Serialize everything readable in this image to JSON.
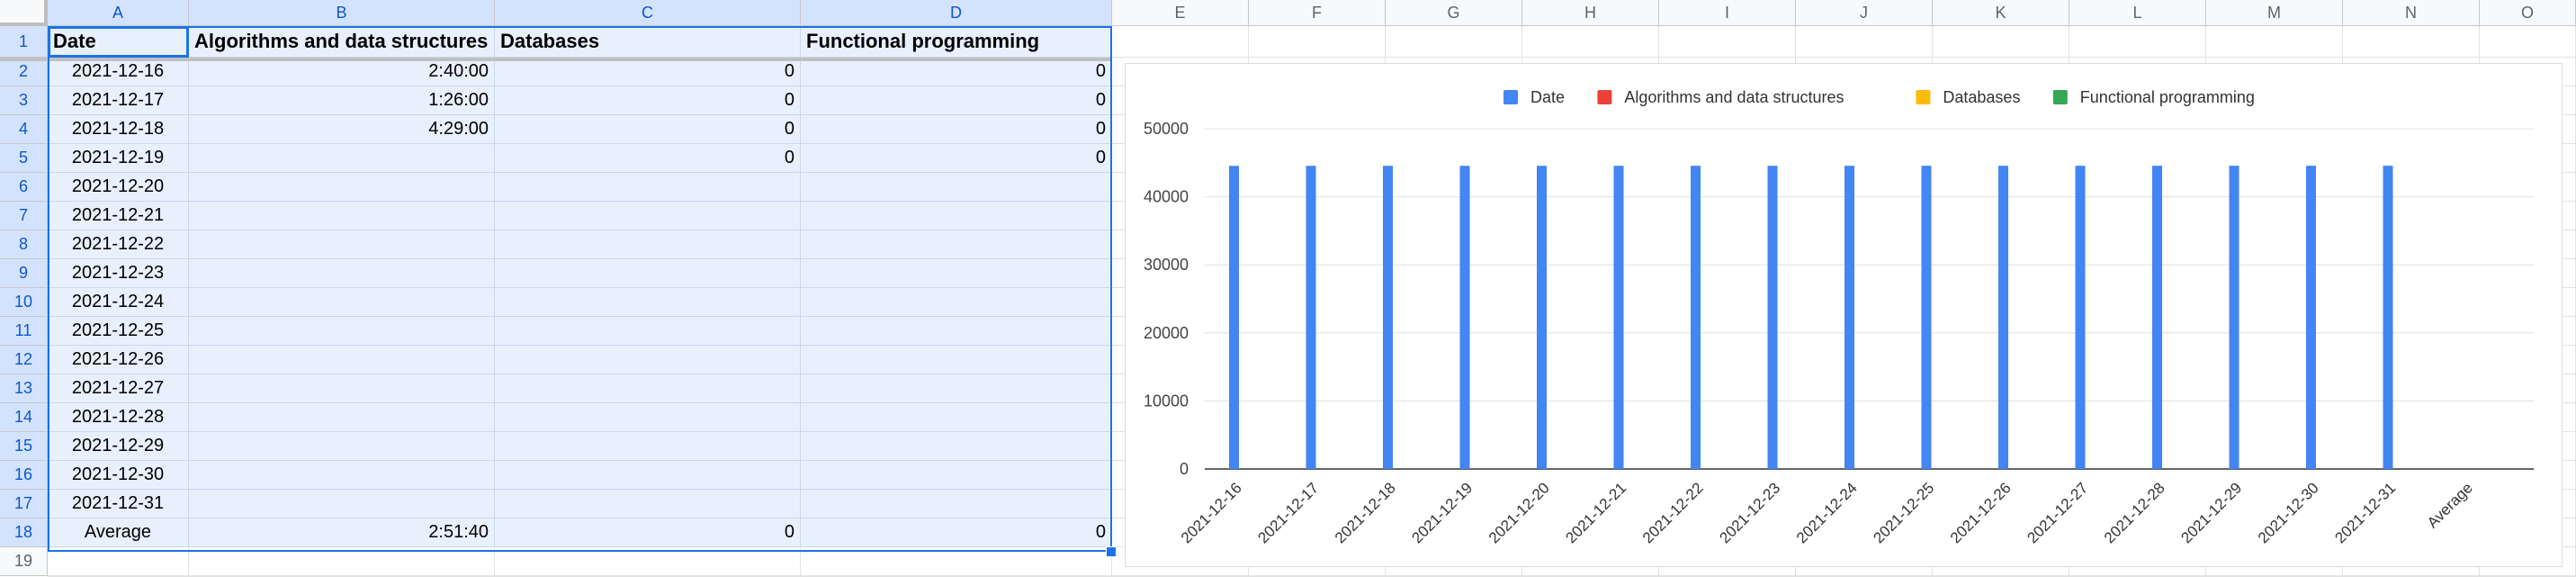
{
  "columns": [
    "A",
    "B",
    "C",
    "D",
    "E",
    "F",
    "G",
    "H",
    "I",
    "J",
    "K",
    "L",
    "M",
    "N",
    "O"
  ],
  "rows": [
    "1",
    "2",
    "3",
    "4",
    "5",
    "6",
    "7",
    "8",
    "9",
    "10",
    "11",
    "12",
    "13",
    "14",
    "15",
    "16",
    "17",
    "18",
    "19"
  ],
  "header": [
    "Date",
    "Algorithms and data structures",
    "Databases",
    "Functional programming"
  ],
  "table": [
    [
      "2021-12-16",
      "2:40:00",
      "0",
      "0"
    ],
    [
      "2021-12-17",
      "1:26:00",
      "0",
      "0"
    ],
    [
      "2021-12-18",
      "4:29:00",
      "0",
      "0"
    ],
    [
      "2021-12-19",
      "",
      "0",
      "0"
    ],
    [
      "2021-12-20",
      "",
      "",
      ""
    ],
    [
      "2021-12-21",
      "",
      "",
      ""
    ],
    [
      "2021-12-22",
      "",
      "",
      ""
    ],
    [
      "2021-12-23",
      "",
      "",
      ""
    ],
    [
      "2021-12-24",
      "",
      "",
      ""
    ],
    [
      "2021-12-25",
      "",
      "",
      ""
    ],
    [
      "2021-12-26",
      "",
      "",
      ""
    ],
    [
      "2021-12-27",
      "",
      "",
      ""
    ],
    [
      "2021-12-28",
      "",
      "",
      ""
    ],
    [
      "2021-12-29",
      "",
      "",
      ""
    ],
    [
      "2021-12-30",
      "",
      "",
      ""
    ],
    [
      "2021-12-31",
      "",
      "",
      ""
    ],
    [
      "Average",
      "2:51:40",
      "0",
      "0"
    ]
  ],
  "colors": {
    "selection_border": "#1a73e8",
    "selection_fill": "#e8f0fe",
    "grid": "#e2e2e2"
  },
  "chart_data": {
    "type": "bar",
    "categories": [
      "2021-12-16",
      "2021-12-17",
      "2021-12-18",
      "2021-12-19",
      "2021-12-20",
      "2021-12-21",
      "2021-12-22",
      "2021-12-23",
      "2021-12-24",
      "2021-12-25",
      "2021-12-26",
      "2021-12-27",
      "2021-12-28",
      "2021-12-29",
      "2021-12-30",
      "2021-12-31",
      "Average"
    ],
    "series": [
      {
        "name": "Date",
        "color": "#4285f4",
        "values": [
          44546,
          44547,
          44548,
          44549,
          44550,
          44551,
          44552,
          44553,
          44554,
          44555,
          44556,
          44557,
          44558,
          44559,
          44560,
          44561,
          null
        ]
      },
      {
        "name": "Algorithms and data structures",
        "color": "#ea4335",
        "values": [
          0.111,
          0.06,
          0.187,
          null,
          null,
          null,
          null,
          null,
          null,
          null,
          null,
          null,
          null,
          null,
          null,
          null,
          0.119
        ]
      },
      {
        "name": "Databases",
        "color": "#fbbc04",
        "values": [
          0,
          0,
          0,
          0,
          null,
          null,
          null,
          null,
          null,
          null,
          null,
          null,
          null,
          null,
          null,
          null,
          0
        ]
      },
      {
        "name": "Functional programming",
        "color": "#34a853",
        "values": [
          0,
          0,
          0,
          0,
          null,
          null,
          null,
          null,
          null,
          null,
          null,
          null,
          null,
          null,
          null,
          null,
          0
        ]
      }
    ],
    "ylim": [
      0,
      50000
    ],
    "yticks": [
      "0",
      "10000",
      "20000",
      "30000",
      "40000",
      "50000"
    ],
    "grid": true,
    "legend_position": "top"
  }
}
